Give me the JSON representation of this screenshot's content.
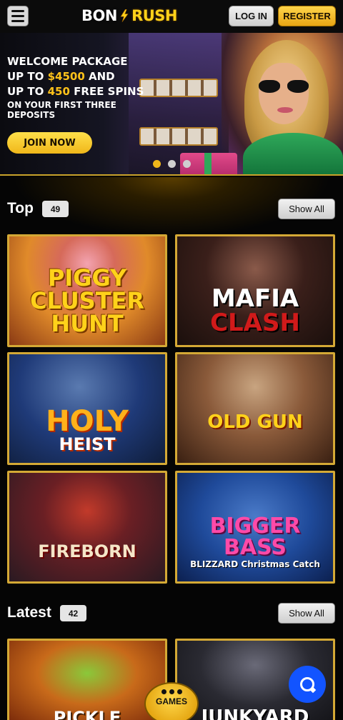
{
  "header": {
    "logo": {
      "left": "BON",
      "right": "RUSH"
    },
    "login_label": "LOG IN",
    "register_label": "REGISTER"
  },
  "banner": {
    "line1": "WELCOME PACKAGE",
    "line2_prefix": "UP TO ",
    "line2_amount": "$4500",
    "line2_suffix": " AND",
    "line3_prefix": "UP TO ",
    "line3_amount": "450",
    "line3_suffix": " FREE SPINS",
    "line4": "ON YOUR FIRST THREE DEPOSITS",
    "cta_label": "JOIN NOW",
    "slides": 3,
    "active_slide": 1
  },
  "sections": {
    "top": {
      "title": "Top",
      "count": "49",
      "show_all": "Show All"
    },
    "latest": {
      "title": "Latest",
      "count": "42",
      "show_all": "Show All"
    }
  },
  "top_games": [
    {
      "title": "PIGGY CLUSTER HUNT"
    },
    {
      "title": "MAFIA",
      "title2": "CLASH"
    },
    {
      "title": "HOLY",
      "title2": "HEIST"
    },
    {
      "title": "OLD GUN"
    },
    {
      "title": "FIREBORN"
    },
    {
      "title": "BIGGER BASS",
      "title2": "BLIZZARD Christmas Catch"
    }
  ],
  "latest_games": [
    {
      "title": "PICKLE"
    },
    {
      "title": "JUNKYARD"
    }
  ],
  "fab": {
    "games_label": "GAMES"
  },
  "colors": {
    "gold": "#d4a935",
    "accent": "#ffc21a",
    "chat": "#1254ff"
  }
}
